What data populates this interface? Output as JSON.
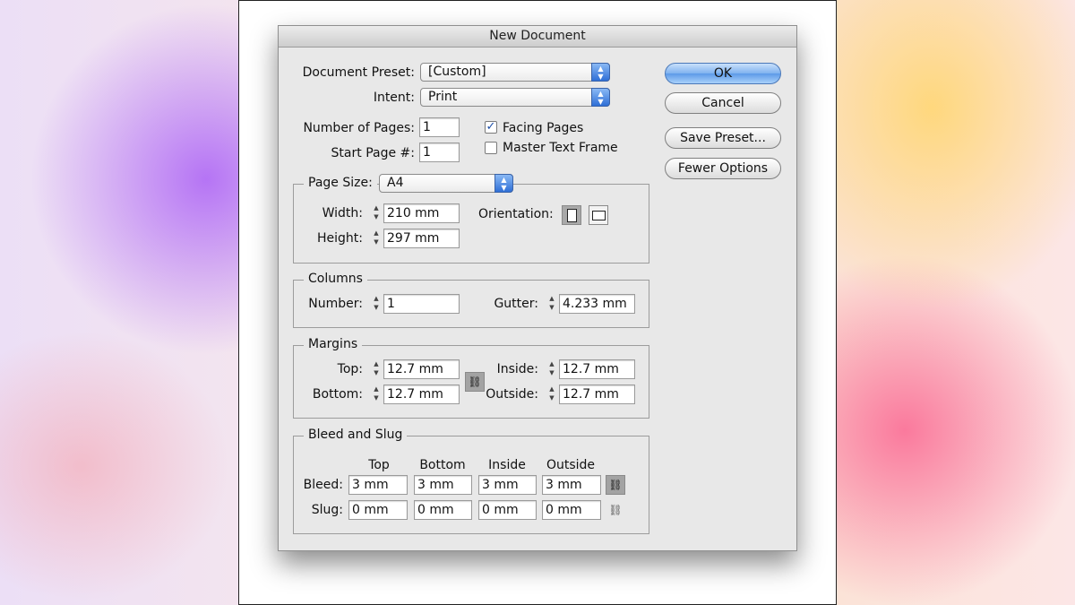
{
  "dialog": {
    "title": "New Document"
  },
  "preset": {
    "label": "Document Preset:",
    "value": "[Custom]"
  },
  "intent": {
    "label": "Intent:",
    "value": "Print"
  },
  "pages": {
    "number_label": "Number of Pages:",
    "number_value": "1",
    "start_label": "Start Page #:",
    "start_value": "1",
    "facing_label": "Facing Pages",
    "facing_checked": true,
    "master_label": "Master Text Frame",
    "master_checked": false
  },
  "page_size": {
    "label": "Page Size:",
    "value": "A4",
    "width_label": "Width:",
    "width_value": "210 mm",
    "height_label": "Height:",
    "height_value": "297 mm",
    "orientation_label": "Orientation:",
    "orientation_selected": "portrait"
  },
  "columns": {
    "legend": "Columns",
    "number_label": "Number:",
    "number_value": "1",
    "gutter_label": "Gutter:",
    "gutter_value": "4.233 mm"
  },
  "margins": {
    "legend": "Margins",
    "top_label": "Top:",
    "top_value": "12.7 mm",
    "bottom_label": "Bottom:",
    "bottom_value": "12.7 mm",
    "inside_label": "Inside:",
    "inside_value": "12.7 mm",
    "outside_label": "Outside:",
    "outside_value": "12.7 mm"
  },
  "bleed_slug": {
    "legend": "Bleed and Slug",
    "headers": [
      "Top",
      "Bottom",
      "Inside",
      "Outside"
    ],
    "bleed_label": "Bleed:",
    "bleed_values": [
      "3 mm",
      "3 mm",
      "3 mm",
      "3 mm"
    ],
    "slug_label": "Slug:",
    "slug_values": [
      "0 mm",
      "0 mm",
      "0 mm",
      "0 mm"
    ]
  },
  "buttons": {
    "ok": "OK",
    "cancel": "Cancel",
    "save_preset": "Save Preset...",
    "fewer_options": "Fewer Options"
  },
  "colors": {
    "accent": "#3f7fe0",
    "dialog_bg": "#e8e8e8"
  }
}
